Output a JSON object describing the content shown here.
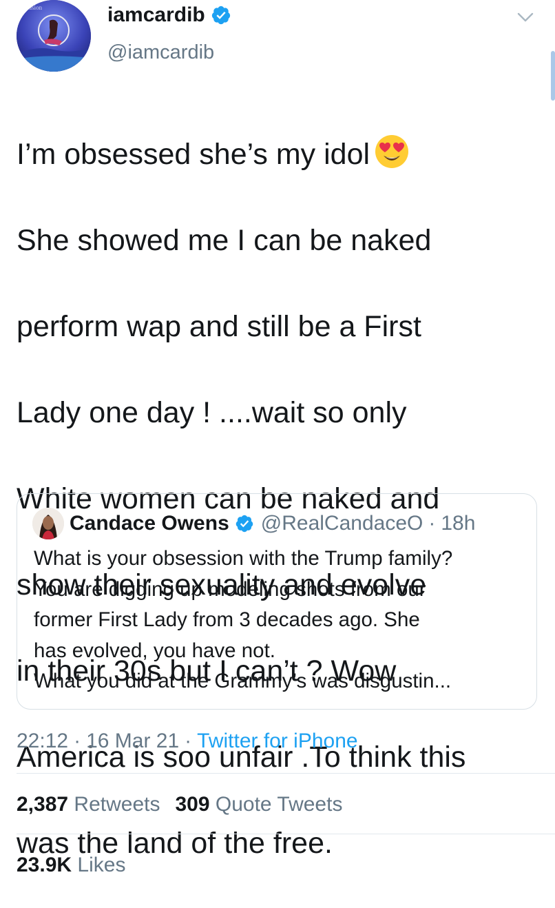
{
  "author": {
    "display_name": "iamcardib",
    "handle": "@iamcardib",
    "verified": true
  },
  "tweet": {
    "lines": [
      "I’m obsessed she’s my idol",
      "She showed  me I can be naked",
      "perform wap and still be a First",
      "Lady one day ! ....wait so only",
      "White women can be naked and",
      "show their sexuality and evolve",
      "in their 30s but I can’t ? Wow",
      "America is soo unfair .To think this",
      "was the land of the free."
    ],
    "emoji": "smiling-face-with-heart-eyes-emoji"
  },
  "quote": {
    "display_name": "Candace Owens",
    "handle": "@RealCandaceO",
    "dot": "·",
    "time": "18h",
    "lines": [
      "What is your obsession with the Trump family?",
      "You are digging up modeling shots from our",
      "former First Lady from 3 decades ago. She",
      "has evolved, you have not.",
      "What you did at the Grammy’s was disgustin..."
    ]
  },
  "meta": {
    "time": "22:12",
    "sep": "·",
    "date": "16 Mar 21",
    "source": "Twitter for iPhone"
  },
  "stats": {
    "retweets_count": "2,387",
    "retweets_label": "Retweets",
    "quotes_count": "309",
    "quotes_label": "Quote Tweets",
    "likes_count": "23.9K",
    "likes_label": "Likes"
  },
  "colors": {
    "verified_blue": "#1da1f2",
    "secondary_text": "#657786",
    "link": "#1da1f2",
    "primary_text": "#14171a"
  }
}
